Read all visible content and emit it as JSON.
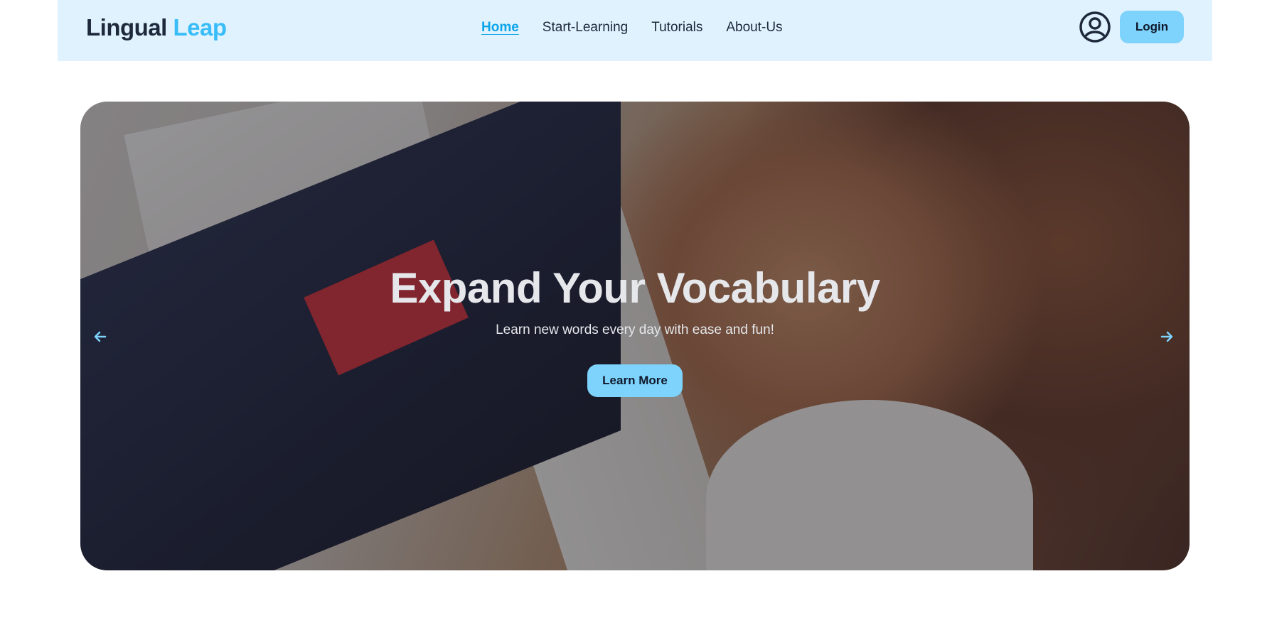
{
  "header": {
    "logo_part1": "Lingual",
    "logo_part2": "Leap",
    "nav": [
      {
        "label": "Home",
        "active": true
      },
      {
        "label": "Start-Learning",
        "active": false
      },
      {
        "label": "Tutorials",
        "active": false
      },
      {
        "label": "About-Us",
        "active": false
      }
    ],
    "login_label": "Login"
  },
  "hero": {
    "title": "Expand Your Vocabulary",
    "subtitle": "Learn new words every day with ease and fun!",
    "cta_label": "Learn More",
    "prev_icon": "arrow-left-icon",
    "next_icon": "arrow-right-icon"
  },
  "colors": {
    "nav_bg": "#e0f2fe",
    "accent": "#38bdf8",
    "button_bg": "#7dd3fc",
    "active_link": "#0ea5e9"
  }
}
